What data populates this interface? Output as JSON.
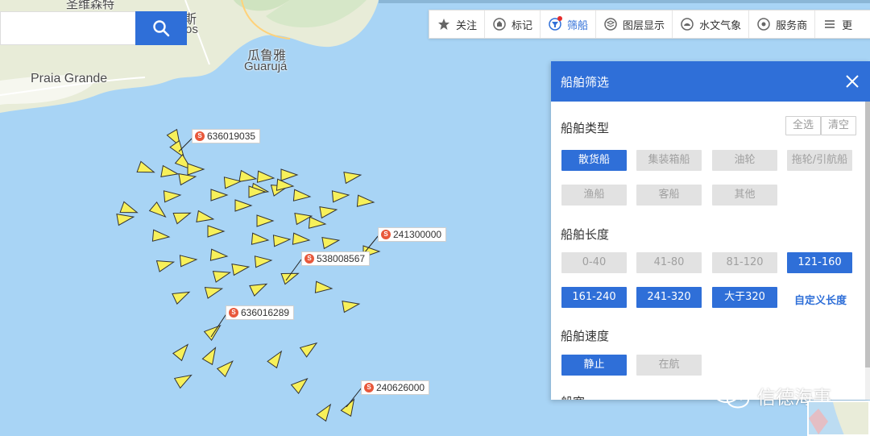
{
  "map": {
    "places": [
      {
        "name": "圣维森特",
        "key": "sao_vicente"
      },
      {
        "name": "斯",
        "key": "santos_cn"
      },
      {
        "name": "os",
        "key": "santos_latin"
      },
      {
        "name": "瓜鲁雅",
        "key": "guaruja_cn"
      },
      {
        "name": "Guarujá",
        "key": "guaruja"
      },
      {
        "name": "Praia Grande",
        "key": "praia_grande"
      }
    ],
    "vessel_labels": [
      "636019035",
      "241300000",
      "538008567",
      "636016289",
      "240626000"
    ],
    "vessel_count": 60,
    "vessel_color": "#f7f05a",
    "water_color": "#a8d4f5",
    "land_color": "#e8ecd8"
  },
  "search": {
    "placeholder": "",
    "icon": "search-icon"
  },
  "toolbar": {
    "items": [
      {
        "label": "关注",
        "icon": "star-icon"
      },
      {
        "label": "标记",
        "icon": "tag-icon"
      },
      {
        "label": "筛船",
        "icon": "filter-icon",
        "active": true
      },
      {
        "label": "图层显示",
        "icon": "layers-icon"
      },
      {
        "label": "水文气象",
        "icon": "weather-icon"
      },
      {
        "label": "服务商",
        "icon": "service-icon"
      },
      {
        "label": "更",
        "icon": "menu-icon"
      }
    ]
  },
  "filter_panel": {
    "title": "船舶筛选",
    "type_section": {
      "title": "船舶类型",
      "select_all": "全选",
      "clear": "清空",
      "options": [
        {
          "label": "散货船",
          "selected": true
        },
        {
          "label": "集装箱船",
          "selected": false
        },
        {
          "label": "油轮",
          "selected": false
        },
        {
          "label": "拖轮/引航船",
          "selected": false
        },
        {
          "label": "渔船",
          "selected": false
        },
        {
          "label": "客船",
          "selected": false
        },
        {
          "label": "其他",
          "selected": false
        }
      ]
    },
    "length_section": {
      "title": "船舶长度",
      "options": [
        {
          "label": "0-40",
          "selected": false
        },
        {
          "label": "41-80",
          "selected": false
        },
        {
          "label": "81-120",
          "selected": false
        },
        {
          "label": "121-160",
          "selected": true
        },
        {
          "label": "161-240",
          "selected": true
        },
        {
          "label": "241-320",
          "selected": true
        },
        {
          "label": "大于320",
          "selected": true
        }
      ],
      "custom_link": "自定义长度"
    },
    "speed_section": {
      "title": "船舶速度",
      "options": [
        {
          "label": "静止",
          "selected": true
        },
        {
          "label": "在航",
          "selected": false
        }
      ]
    },
    "next_section_title": "船宽"
  },
  "watermark": {
    "text": "信德海事",
    "icon": "wechat-icon"
  },
  "accent_color": "#2f6fd8"
}
